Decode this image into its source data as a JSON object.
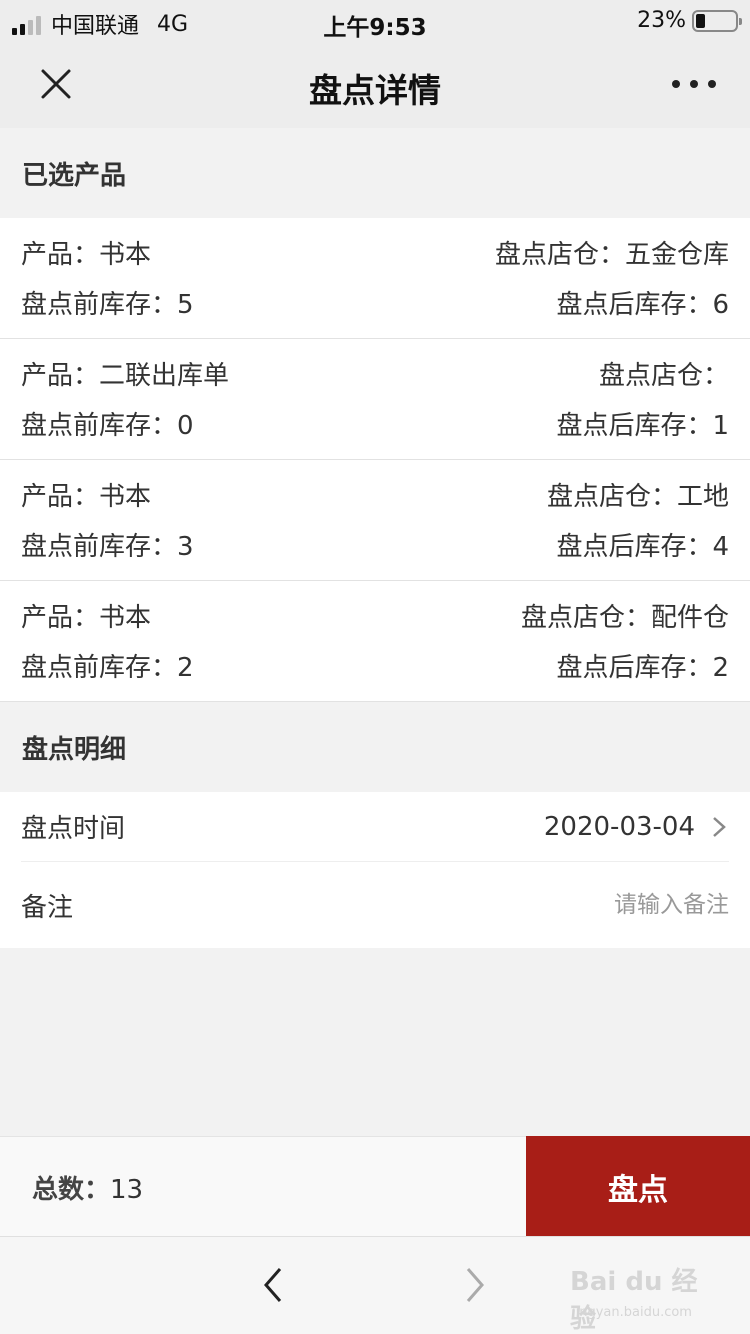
{
  "status_bar": {
    "carrier": "中国联通",
    "network": "4G",
    "time": "上午9:53",
    "battery_percent": "23%",
    "battery_level": 0.23
  },
  "nav": {
    "title": "盘点详情",
    "close_icon": "close-icon",
    "more_icon": "more-icon"
  },
  "selected_products": {
    "header": "已选产品",
    "items": [
      {
        "product_label": "产品：",
        "product": "书本",
        "warehouse_label": "盘点店仓：",
        "warehouse": "五金仓库",
        "before_label": "盘点前库存：",
        "before": "5",
        "after_label": "盘点后库存：",
        "after": "6"
      },
      {
        "product_label": "产品：",
        "product": "二联出库单",
        "warehouse_label": "盘点店仓：",
        "warehouse": "",
        "before_label": "盘点前库存：",
        "before": "0",
        "after_label": "盘点后库存：",
        "after": "1"
      },
      {
        "product_label": "产品：",
        "product": "书本",
        "warehouse_label": "盘点店仓：",
        "warehouse": "工地",
        "before_label": "盘点前库存：",
        "before": "3",
        "after_label": "盘点后库存：",
        "after": "4"
      },
      {
        "product_label": "产品：",
        "product": "书本",
        "warehouse_label": "盘点店仓：",
        "warehouse": "配件仓",
        "before_label": "盘点前库存：",
        "before": "2",
        "after_label": "盘点后库存：",
        "after": "2"
      }
    ]
  },
  "details": {
    "header": "盘点明细",
    "time_label": "盘点时间",
    "time_value": "2020-03-04",
    "note_label": "备注",
    "note_placeholder": "请输入备注",
    "note_value": ""
  },
  "footer": {
    "total_label": "总数：",
    "total_value": "13",
    "submit_label": "盘点",
    "accent_color": "#a81e17"
  },
  "browser": {
    "back_icon": "chevron-left-icon",
    "forward_icon": "chevron-right-icon",
    "watermark_main": "Bai du 经验",
    "watermark_sub": "jingyan.baidu.com"
  }
}
